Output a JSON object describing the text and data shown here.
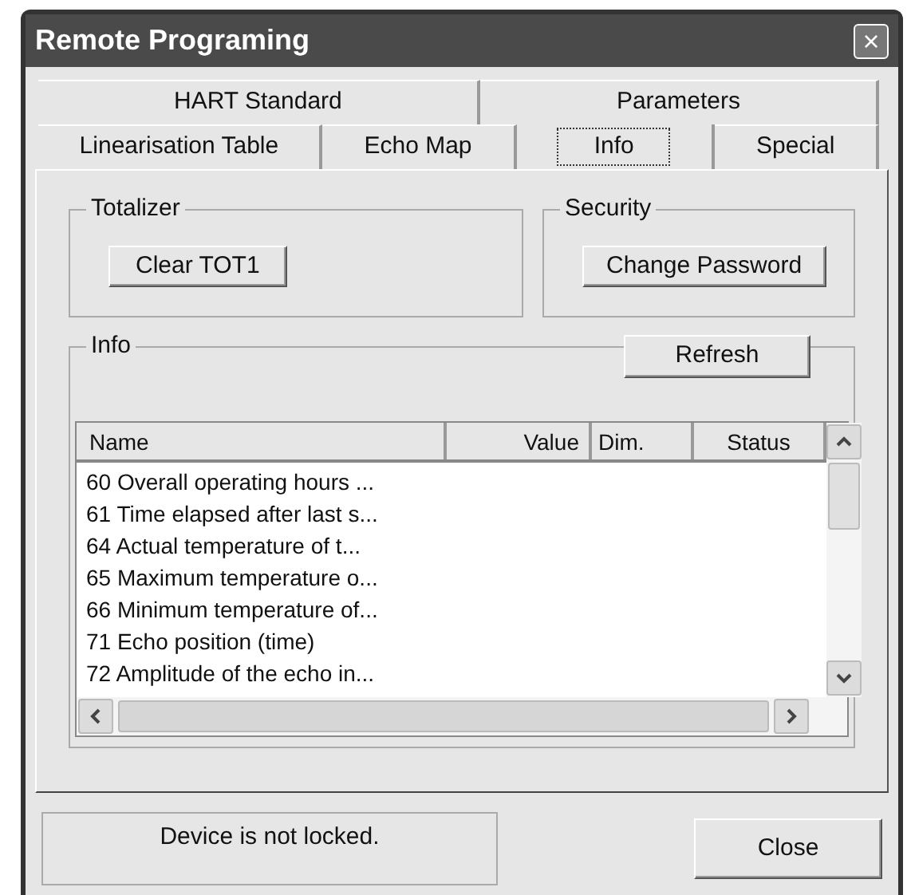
{
  "window": {
    "title": "Remote Programing",
    "close": "×"
  },
  "tabs": {
    "rows": [
      [
        {
          "label": "HART Standard",
          "selected": false
        },
        {
          "label": "Parameters",
          "selected": false
        }
      ],
      [
        {
          "label": "Linearisation Table",
          "selected": false
        },
        {
          "label": "Echo Map",
          "selected": false
        },
        {
          "label": "Info",
          "selected": true
        },
        {
          "label": "Special",
          "selected": false
        }
      ]
    ]
  },
  "totalizer": {
    "title": "Totalizer",
    "button": "Clear TOT1"
  },
  "security": {
    "title": "Security",
    "button": "Change Password"
  },
  "info": {
    "title": "Info",
    "refresh_button": "Refresh",
    "table": {
      "columns": [
        "Name",
        "Value",
        "Dim.",
        "Status"
      ],
      "rows": [
        {
          "name": "60 Overall operating hours ..."
        },
        {
          "name": "61 Time elapsed after last s..."
        },
        {
          "name": "64 Actual temperature of t..."
        },
        {
          "name": "65 Maximum temperature o..."
        },
        {
          "name": "66 Minimum temperature of..."
        },
        {
          "name": "71 Echo position (time)"
        },
        {
          "name": "72 Amplitude of the echo in..."
        }
      ]
    }
  },
  "status_text": "Device is not locked.",
  "close_button": "Close"
}
